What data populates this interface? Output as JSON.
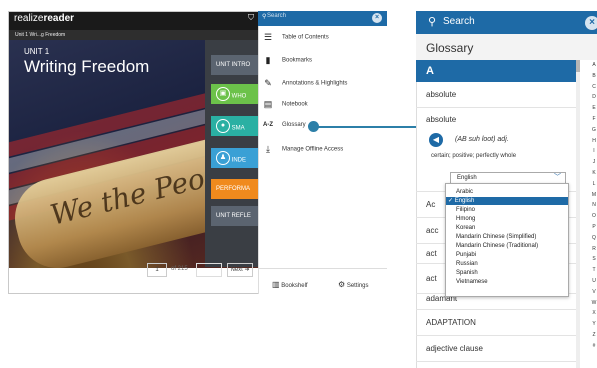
{
  "reader": {
    "brand_light": "realize",
    "brand_bold": "reader",
    "breadcrumb": "Unit 1 Wri...g Freedom",
    "unit_number": "UNIT 1",
    "unit_title": "Writing Freedom",
    "cover_script": "We the People",
    "lessons": [
      {
        "label": "UNIT INTRO",
        "color": "#5b6470"
      },
      {
        "label": "WHO",
        "color": "#6cc24a"
      },
      {
        "label": "SMA",
        "color": "#2ab0a3"
      },
      {
        "label": "INDE",
        "color": "#3aa0d5"
      },
      {
        "label": "PERFORMA",
        "color": "#f08a1d"
      },
      {
        "label": "UNIT REFLE",
        "color": "#5b6470"
      }
    ],
    "page_number": "1",
    "page_of": "of 215",
    "prev_label": "",
    "next_label": "Next ➜"
  },
  "menu": {
    "search_placeholder": "Search",
    "items": [
      {
        "label": "Table of Contents",
        "icon": "list-icon"
      },
      {
        "label": "Bookmarks",
        "icon": "bookmark-icon"
      },
      {
        "label": "Annotations & Highlights",
        "icon": "pencil-icon"
      },
      {
        "label": "Notebook",
        "icon": "notebook-icon"
      },
      {
        "label": "Glossary",
        "icon": "az-icon"
      },
      {
        "label": "Manage Offline Access",
        "icon": "download-icon"
      }
    ],
    "bookshelf_label": "Bookshelf",
    "settings_label": "Settings"
  },
  "glossary": {
    "search_placeholder": "Search",
    "title": "Glossary",
    "current_letter": "A",
    "terms_top": [
      "absolute"
    ],
    "expanded_term": "absolute",
    "pronunciation": "(AB suh loot) adj.",
    "definition": "certain; positive; perfectly whole",
    "language_selected": "English",
    "language_options": [
      "Arabic",
      "English",
      "Filipino",
      "Hmong",
      "Korean",
      "Mandarin Chinese (Simplified)",
      "Mandarin Chinese (Traditional)",
      "Punjabi",
      "Russian",
      "Spanish",
      "Vietnamese"
    ],
    "terms_partial": [
      "Ac",
      "acc",
      "act",
      "act",
      "adamant"
    ],
    "terms_bottom": [
      "ADAPTATION",
      "adjective clause"
    ],
    "alphabet": [
      "A",
      "B",
      "C",
      "D",
      "E",
      "F",
      "G",
      "H",
      "I",
      "J",
      "K",
      "L",
      "M",
      "N",
      "O",
      "P",
      "Q",
      "R",
      "S",
      "T",
      "U",
      "V",
      "W",
      "X",
      "Y",
      "Z",
      "#"
    ]
  },
  "colors": {
    "accent": "#1e6aa6",
    "connector": "#2c7fa8"
  }
}
